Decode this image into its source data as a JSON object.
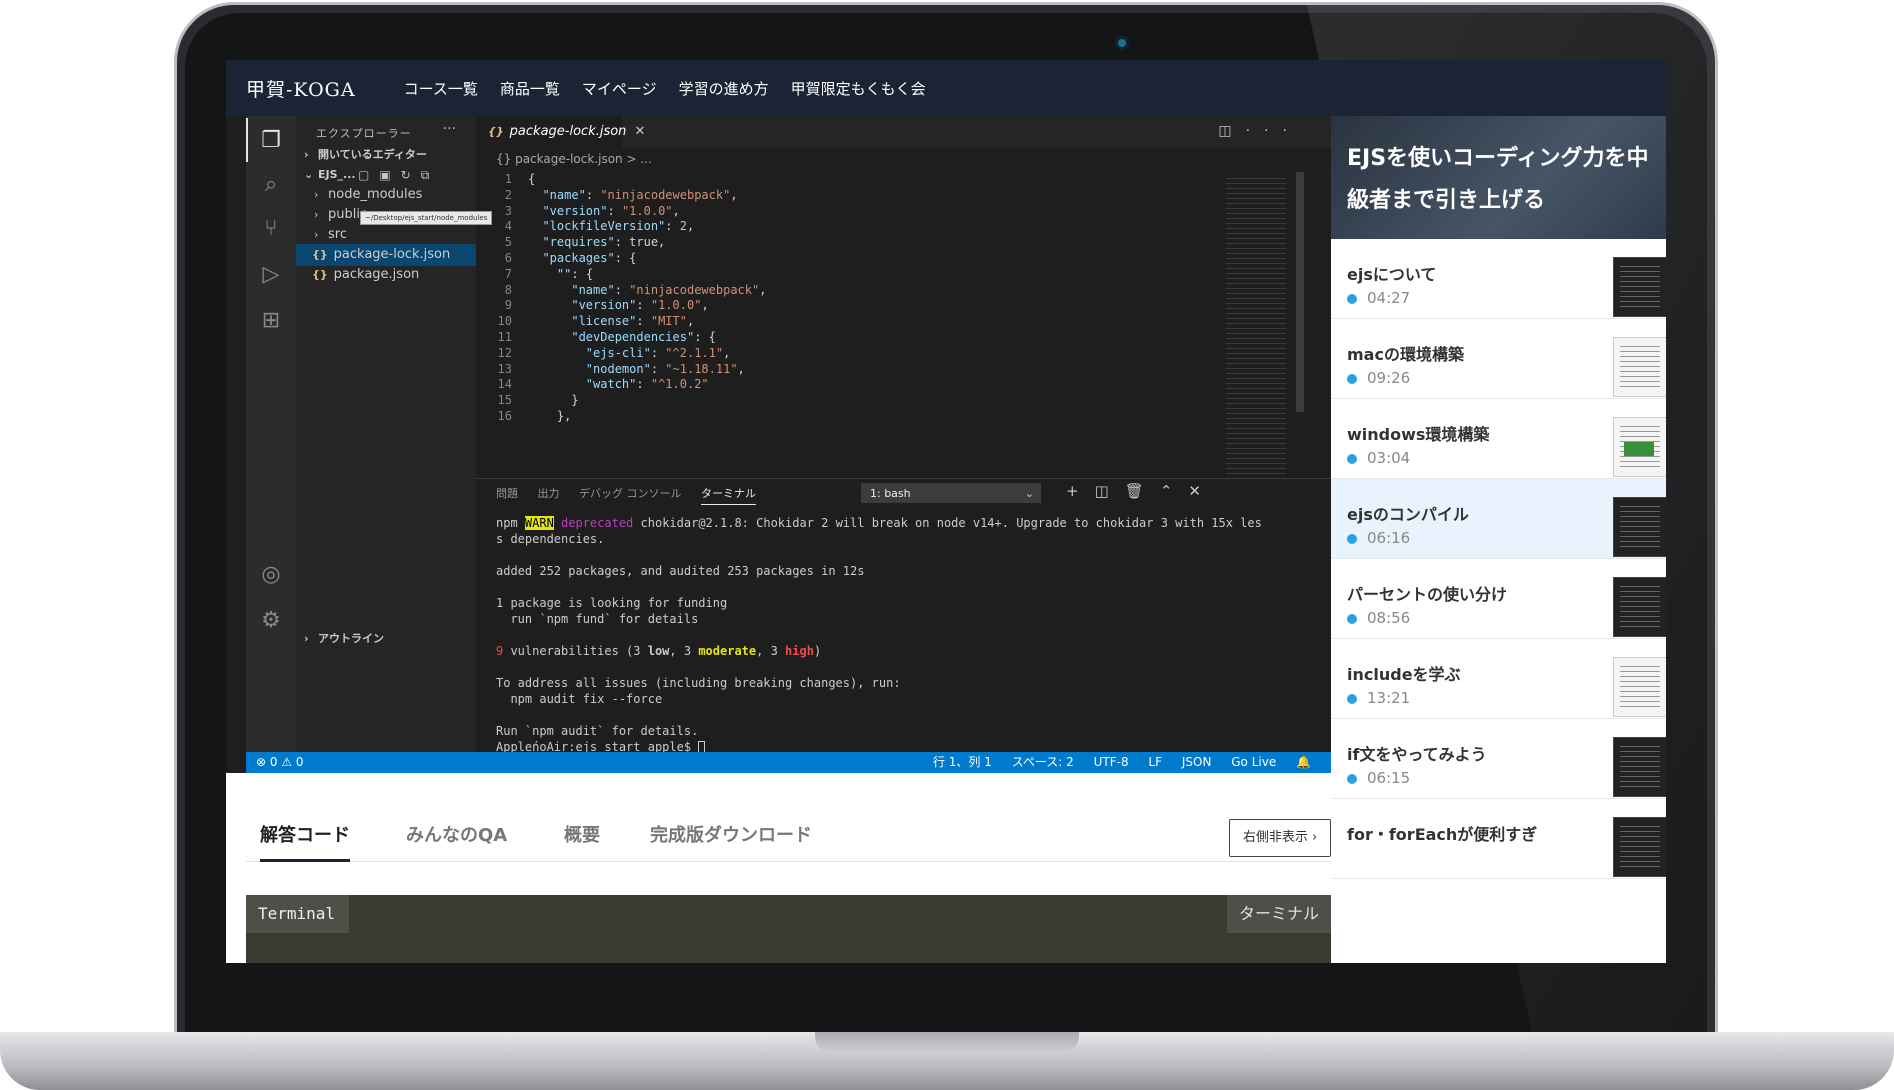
{
  "nav": {
    "brand": "甲賀-KOGA",
    "items": [
      "コース一覧",
      "商品一覧",
      "マイページ",
      "学習の進め方",
      "甲賀限定もくもく会"
    ]
  },
  "vscode": {
    "explorer_title": "エクスプローラー",
    "open_editors": "開いているエディター",
    "folder": "EJS_...",
    "tree": [
      "node_modules",
      "public",
      "src",
      "package-lock.json",
      "package.json"
    ],
    "tooltip": "~/Desktop/ejs_start/node_modules",
    "outline": "アウトライン",
    "tab_label": "package-lock.json",
    "breadcrumb": "{} package-lock.json > ...",
    "code_lines": [
      {
        "n": "1",
        "t": "{"
      },
      {
        "n": "2",
        "t": "  \"name\": \"ninjacodewebpack\","
      },
      {
        "n": "3",
        "t": "  \"version\": \"1.0.0\","
      },
      {
        "n": "4",
        "t": "  \"lockfileVersion\": 2,"
      },
      {
        "n": "5",
        "t": "  \"requires\": true,"
      },
      {
        "n": "6",
        "t": "  \"packages\": {"
      },
      {
        "n": "7",
        "t": "    \"\": {"
      },
      {
        "n": "8",
        "t": "      \"name\": \"ninjacodewebpack\","
      },
      {
        "n": "9",
        "t": "      \"version\": \"1.0.0\","
      },
      {
        "n": "10",
        "t": "      \"license\": \"MIT\","
      },
      {
        "n": "11",
        "t": "      \"devDependencies\": {"
      },
      {
        "n": "12",
        "t": "        \"ejs-cli\": \"^2.1.1\","
      },
      {
        "n": "13",
        "t": "        \"nodemon\": \"~1.18.11\","
      },
      {
        "n": "14",
        "t": "        \"watch\": \"^1.0.2\""
      },
      {
        "n": "15",
        "t": "      }"
      },
      {
        "n": "16",
        "t": "    },"
      }
    ],
    "panel_tabs": [
      "問題",
      "出力",
      "デバッグ コンソール",
      "ターミナル"
    ],
    "terminal_select": "1: bash",
    "terminal": {
      "l1_npm": "npm ",
      "l1_warn": "WARN",
      "l1_deprecated": " deprecated",
      "l1_rest": " chokidar@2.1.8: Chokidar 2 will break on node v14+. Upgrade to chokidar 3 with 15x les",
      "l2": "s dependencies.",
      "l3": "added 252 packages, and audited 253 packages in 12s",
      "l4": "1 package is looking for funding",
      "l5": "  run `npm fund` for details",
      "l6_num": "9",
      "l6_a": " vulnerabilities (3 ",
      "l6_low": "low",
      "l6_b": ", 3 ",
      "l6_mod": "moderate",
      "l6_c": ", 3 ",
      "l6_high": "high",
      "l6_d": ")",
      "l7": "To address all issues (including breaking changes), run:",
      "l8": "  npm audit fix --force",
      "l9": "Run `npm audit` for details.",
      "l10": "AppleńoAir:ejs_start apple$ "
    },
    "status_left": "⊗ 0 ⚠ 0",
    "status_right": [
      "行 1、列 1",
      "スペース: 2",
      "UTF-8",
      "LF",
      "JSON",
      "Go Live"
    ]
  },
  "lesson_tabs": [
    "解答コード",
    "みんなのQA",
    "概要",
    "完成版ダウンロード"
  ],
  "hide_button": "右側非表示",
  "code_card": {
    "left": "Terminal",
    "right": "ターミナル"
  },
  "playlist": {
    "hero_title": "EJSを使いコーディング力を中級者まで引き上げる",
    "items": [
      {
        "title": "ejsについて",
        "duration": "04:27"
      },
      {
        "title": "macの環境構築",
        "duration": "09:26"
      },
      {
        "title": "windows環境構築",
        "duration": "03:04"
      },
      {
        "title": "ejsのコンパイル",
        "duration": "06:16"
      },
      {
        "title": "パーセントの使い分け",
        "duration": "08:56"
      },
      {
        "title": "includeを学ぶ",
        "duration": "13:21"
      },
      {
        "title": "if文をやってみよう",
        "duration": "06:15"
      },
      {
        "title": "for・forEachが便利すぎ",
        "duration": ""
      }
    ]
  }
}
